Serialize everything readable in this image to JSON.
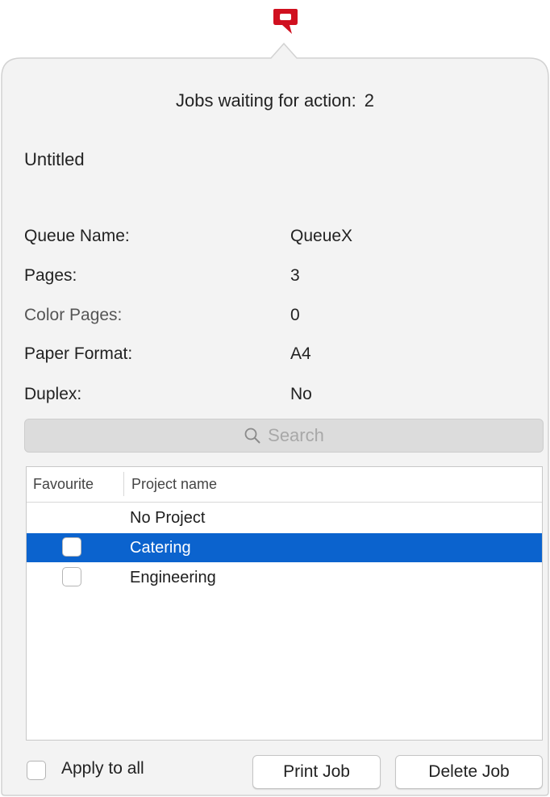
{
  "app": {
    "accent_color": "#0b63ce",
    "logo_color": "#d0101f",
    "logo_icon": "q-logo-icon"
  },
  "header": {
    "jobs_waiting_label": "Jobs waiting for action:",
    "jobs_waiting_count": "2"
  },
  "document": {
    "title": "Untitled"
  },
  "details": [
    {
      "label": "Queue Name:",
      "value": "QueueX"
    },
    {
      "label": "Pages:",
      "value": "3"
    },
    {
      "label": "Color Pages:",
      "value": "0"
    },
    {
      "label": "Paper Format:",
      "value": "A4"
    },
    {
      "label": "Duplex:",
      "value": "No"
    }
  ],
  "search": {
    "placeholder": "Search",
    "icon": "search-icon"
  },
  "projects_table": {
    "columns": [
      "Favourite",
      "Project name"
    ],
    "rows": [
      {
        "name": "No Project",
        "favourite_checkbox": false,
        "checked": false,
        "selected": false
      },
      {
        "name": "Catering",
        "favourite_checkbox": true,
        "checked": false,
        "selected": true
      },
      {
        "name": "Engineering",
        "favourite_checkbox": true,
        "checked": false,
        "selected": false
      }
    ]
  },
  "footer": {
    "apply_to_all_label": "Apply to all",
    "apply_to_all_checked": false,
    "print_button": "Print Job",
    "delete_button": "Delete Job"
  }
}
